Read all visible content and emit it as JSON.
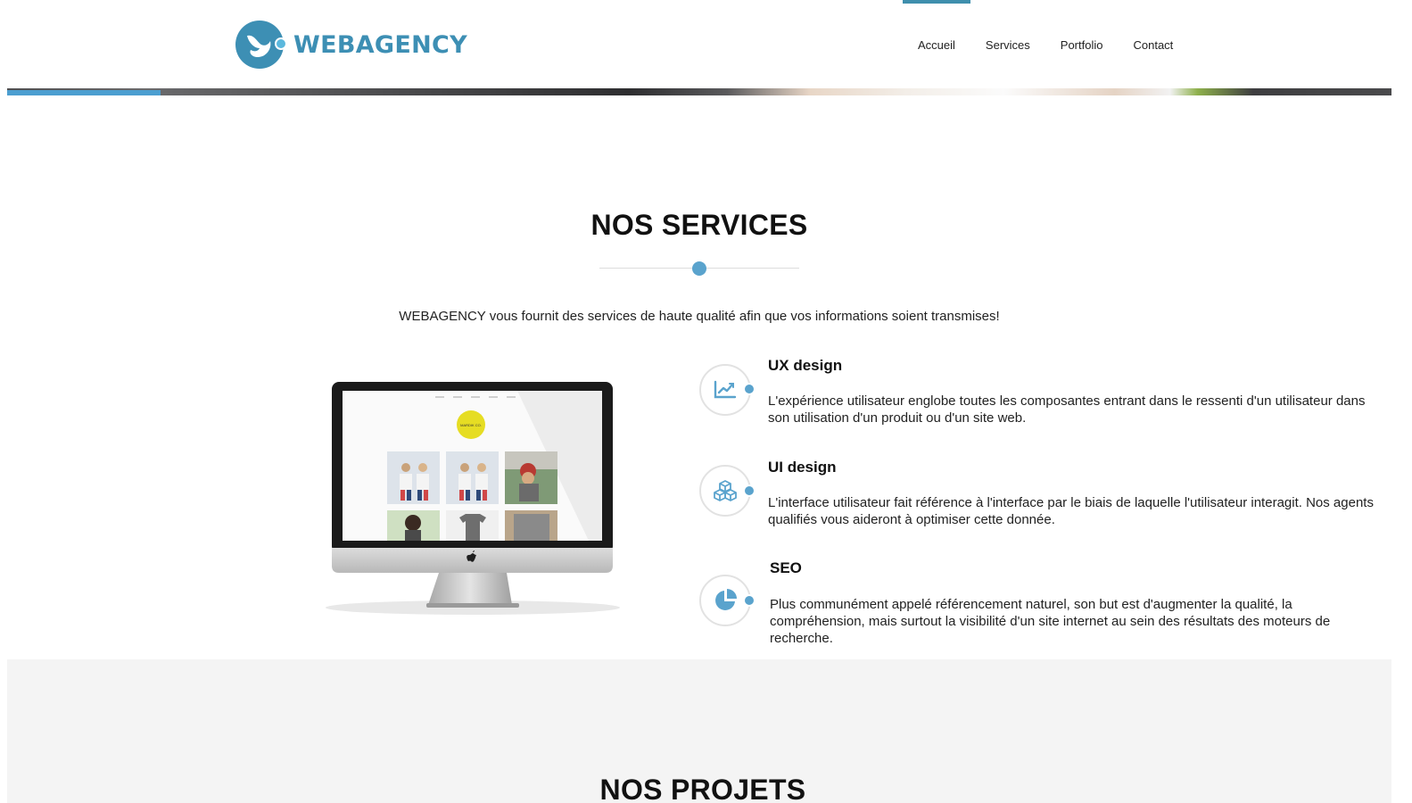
{
  "brand": {
    "name": "WEBAGENCY",
    "color": "#3d8fb4",
    "accent": "#5aa3cd"
  },
  "nav": {
    "items": [
      {
        "label": "Accueil",
        "active": true
      },
      {
        "label": "Services",
        "active": false
      },
      {
        "label": "Portfolio",
        "active": false
      },
      {
        "label": "Contact",
        "active": false
      }
    ]
  },
  "services": {
    "title": "NOS SERVICES",
    "intro": "WEBAGENCY vous fournit des services de haute qualité afin que vos informations soient transmises!",
    "items": [
      {
        "title": "UX design",
        "icon": "line-chart-icon",
        "description": "L'expérience utilisateur englobe toutes les composantes entrant dans le ressenti d'un utilisateur dans son utilisation d'un produit ou d'un site web."
      },
      {
        "title": "UI design",
        "icon": "cubes-icon",
        "description": "L'interface utilisateur fait référence à l'interface par le biais de laquelle l'utilisateur interagit. Nos agents qualifiés vous aideront à optimiser cette donnée."
      },
      {
        "title": "SEO",
        "icon": "pie-chart-icon",
        "description": "Plus communément appelé référencement naturel, son but est d'augmenter la qualité, la compréhension, mais surtout la visibilité d'un site internet au sein des résultats des moteurs de recherche."
      }
    ]
  },
  "mockup": {
    "site_logo_text": "MARDIK CO."
  },
  "projects": {
    "title": "NOS PROJETS"
  }
}
